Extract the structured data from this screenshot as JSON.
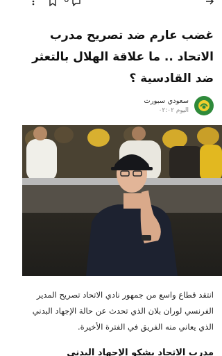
{
  "toolbar": {
    "comment_count": "0",
    "icons": [
      "back-arrow-icon",
      "bookmark-icon",
      "comment-icon",
      "more-icon"
    ]
  },
  "article": {
    "headline": "غضب عارم ضد تصريح مدرب الاتحاد .. ما علاقة الهلال بالتعثر ضد القادسية ؟",
    "source_name": "سعودي سبورت",
    "source_time": "اليوم ٠٢:٠٢",
    "body": "انتقد قطاع واسع من جمهور نادي الاتحاد تصريح المدير الفرنسي لوران بلان الذي تحدث عن حالة الإجهاد البدني الذي يعاني منه الفريق في الفترة الأخيرة.",
    "next_line": "مدرب الاتحاد يشكو الإجهاد البدني"
  },
  "colors": {
    "logo_green": "#2f8a3b",
    "logo_yellow": "#f2cf2e"
  }
}
